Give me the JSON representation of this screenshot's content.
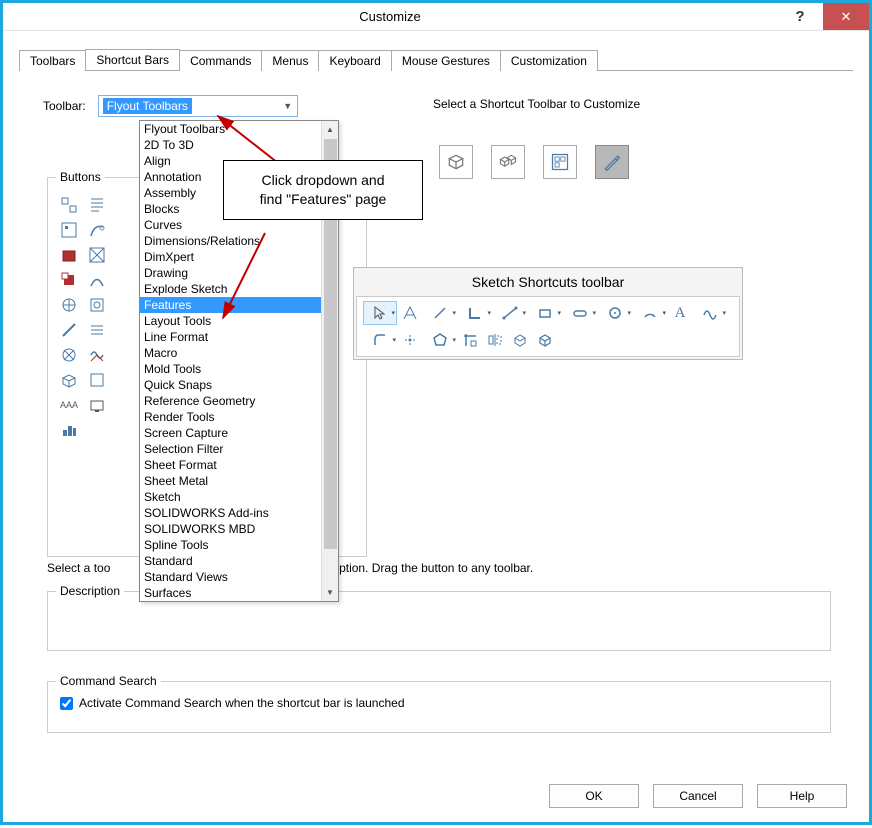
{
  "title": "Customize",
  "tabs": [
    "Toolbars",
    "Shortcut Bars",
    "Commands",
    "Menus",
    "Keyboard",
    "Mouse Gestures",
    "Customization"
  ],
  "active_tab": 1,
  "toolbar_label": "Toolbar:",
  "combo_selected": "Flyout Toolbars",
  "select_heading": "Select a Shortcut Toolbar to Customize",
  "buttons_legend": "Buttons",
  "dropdown_items": [
    "Flyout Toolbars",
    "2D To 3D",
    "Align",
    "Annotation",
    "Assembly",
    "Blocks",
    "Curves",
    "Dimensions/Relations",
    "DimXpert",
    "Drawing",
    "Explode Sketch",
    "Features",
    "Layout Tools",
    "Line Format",
    "Macro",
    "Mold Tools",
    "Quick Snaps",
    "Reference Geometry",
    "Render Tools",
    "Screen Capture",
    "Selection Filter",
    "Sheet Format",
    "Sheet Metal",
    "Sketch",
    "SOLIDWORKS Add-ins",
    "SOLIDWORKS MBD",
    "Spline Tools",
    "Standard",
    "Standard Views",
    "Surfaces"
  ],
  "dropdown_highlight_index": 11,
  "callout_l1": "Click dropdown and",
  "callout_l2": "find \"Features\" page",
  "sketch_title": "Sketch Shortcuts toolbar",
  "instruction_prefix": "Select a too",
  "instruction_suffix": "description. Drag the button to any toolbar.",
  "description_legend": "Description",
  "command_legend": "Command Search",
  "command_check_label": "Activate Command Search when the shortcut bar is launched",
  "command_checked": true,
  "buttons": {
    "ok": "OK",
    "cancel": "Cancel",
    "help": "Help"
  }
}
